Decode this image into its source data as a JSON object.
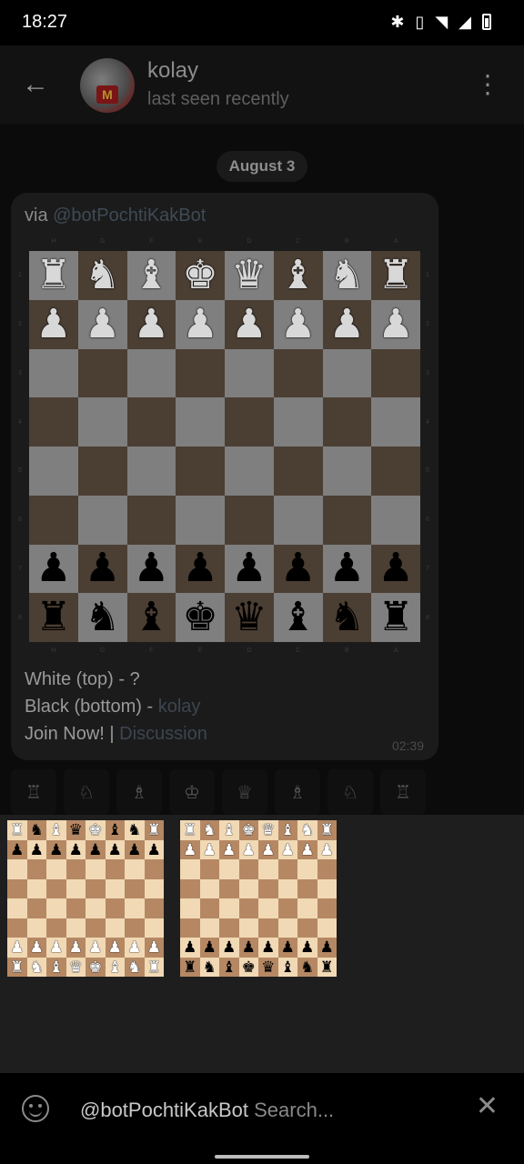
{
  "status": {
    "time": "18:27"
  },
  "header": {
    "name": "kolay",
    "status": "last seen recently"
  },
  "date_chip": "August 3",
  "message": {
    "via_prefix": "via ",
    "bot": "@botPochtiKakBot",
    "files": [
      "H",
      "G",
      "F",
      "E",
      "D",
      "C",
      "B",
      "A"
    ],
    "ranks": [
      "1",
      "2",
      "3",
      "4",
      "5",
      "6",
      "7",
      "8"
    ],
    "board": [
      [
        "wr",
        "wn",
        "wb",
        "wk",
        "wq",
        "wb",
        "wn",
        "wr"
      ],
      [
        "wp",
        "wp",
        "wp",
        "wp",
        "wp",
        "wp",
        "wp",
        "wp"
      ],
      [
        "",
        "",
        "",
        "",
        "",
        "",
        "",
        ""
      ],
      [
        "",
        "",
        "",
        "",
        "",
        "",
        "",
        ""
      ],
      [
        "",
        "",
        "",
        "",
        "",
        "",
        "",
        ""
      ],
      [
        "",
        "",
        "",
        "",
        "",
        "",
        "",
        ""
      ],
      [
        "bp",
        "bp",
        "bp",
        "bp",
        "bp",
        "bp",
        "bp",
        "bp"
      ],
      [
        "br",
        "bn",
        "bb",
        "bk",
        "bq",
        "bb",
        "bn",
        "br"
      ]
    ],
    "white_line": "White (top) - ?",
    "black_prefix": "Black (bottom) - ",
    "black_user": "kolay",
    "join_text": "Join Now! | ",
    "discussion": "Discussion",
    "time": "02:39"
  },
  "piece_buttons": [
    "♖",
    "♘",
    "♗",
    "♔",
    "♕",
    "♗",
    "♘",
    "♖"
  ],
  "results": [
    {
      "board": [
        [
          "wr",
          "bn",
          "wb",
          "bq",
          "wk",
          "bb",
          "bn",
          "wr"
        ],
        [
          "bp",
          "bp",
          "bp",
          "bp",
          "bp",
          "bp",
          "bp",
          "bp"
        ],
        [
          "",
          "",
          "",
          "",
          "",
          "",
          "",
          ""
        ],
        [
          "",
          "",
          "",
          "",
          "",
          "",
          "",
          ""
        ],
        [
          "",
          "",
          "",
          "",
          "",
          "",
          "",
          ""
        ],
        [
          "",
          "",
          "",
          "",
          "",
          "",
          "",
          ""
        ],
        [
          "wp",
          "wp",
          "wp",
          "wp",
          "wp",
          "wp",
          "wp",
          "wp"
        ],
        [
          "wr",
          "wn",
          "wb",
          "wq",
          "wk",
          "wb",
          "wn",
          "wr"
        ]
      ]
    },
    {
      "board": [
        [
          "wr",
          "wn",
          "wb",
          "wk",
          "wq",
          "wb",
          "wn",
          "wr"
        ],
        [
          "wp",
          "wp",
          "wp",
          "wp",
          "wp",
          "wp",
          "wp",
          "wp"
        ],
        [
          "",
          "",
          "",
          "",
          "",
          "",
          "",
          ""
        ],
        [
          "",
          "",
          "",
          "",
          "",
          "",
          "",
          ""
        ],
        [
          "",
          "",
          "",
          "",
          "",
          "",
          "",
          ""
        ],
        [
          "",
          "",
          "",
          "",
          "",
          "",
          "",
          ""
        ],
        [
          "bp",
          "bp",
          "bp",
          "bp",
          "bp",
          "bp",
          "bp",
          "bp"
        ],
        [
          "br",
          "bn",
          "bb",
          "bk",
          "bq",
          "bb",
          "bn",
          "br"
        ]
      ]
    }
  ],
  "input": {
    "value": "@botPochtiKakBot",
    "placeholder": "Search..."
  }
}
